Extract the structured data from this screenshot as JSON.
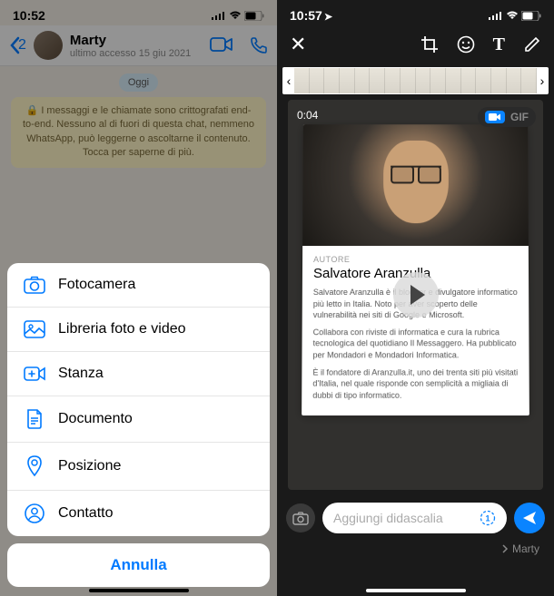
{
  "left": {
    "status": {
      "time": "10:52",
      "has_location": true
    },
    "header": {
      "back_count": "2",
      "contact_name": "Marty",
      "last_seen": "ultimo accesso 15 giu 2021"
    },
    "chat": {
      "date_label": "Oggi",
      "encryption_text": "🔒 I messaggi e le chiamate sono crittografati end-to-end. Nessuno al di fuori di questa chat, nemmeno WhatsApp, può leggerne o ascoltarne il contenuto. Tocca per saperne di più."
    },
    "sheet": {
      "items": [
        {
          "icon": "camera",
          "label": "Fotocamera"
        },
        {
          "icon": "gallery",
          "label": "Libreria foto e video"
        },
        {
          "icon": "room",
          "label": "Stanza"
        },
        {
          "icon": "document",
          "label": "Documento"
        },
        {
          "icon": "location",
          "label": "Posizione"
        },
        {
          "icon": "contact",
          "label": "Contatto"
        }
      ],
      "cancel": "Annulla"
    }
  },
  "right": {
    "status": {
      "time": "10:57",
      "has_location": true
    },
    "editor": {
      "video_time": "0:04",
      "gif_label": "GIF",
      "article": {
        "tag": "AUTORE",
        "title": "Salvatore Aranzulla",
        "p1": "Salvatore Aranzulla è il blogger e divulgatore informatico più letto in Italia. Noto per aver scoperto delle vulnerabilità nei siti di Google e Microsoft.",
        "p2": "Collabora con riviste di informatica e cura la rubrica tecnologica del quotidiano Il Messaggero. Ha pubblicato per Mondadori e Mondadori Informatica.",
        "p3": "È il fondatore di Aranzulla.it, uno dei trenta siti più visitati d'Italia, nel quale risponde con semplicità a migliaia di dubbi di tipo informatico."
      },
      "caption_placeholder": "Aggiungi didascalia",
      "recipient": "Marty"
    }
  }
}
